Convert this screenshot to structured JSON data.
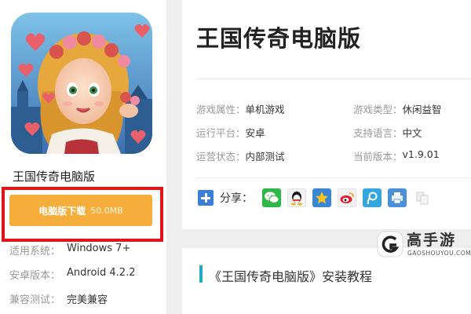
{
  "app": {
    "name": "王国传奇电脑版",
    "title": "王国传奇电脑版"
  },
  "download": {
    "label": "电脑版下载",
    "size": "50.0MB"
  },
  "meta": [
    {
      "key": "适用系统：",
      "value": "Windows 7+"
    },
    {
      "key": "安卓版本：",
      "value": "Android 4.2.2"
    },
    {
      "key": "兼容测试：",
      "value": "完美兼容"
    }
  ],
  "attributes": [
    {
      "key": "游戏属性：",
      "value": "单机游戏"
    },
    {
      "key": "游戏类型：",
      "value": "休闲益智"
    },
    {
      "key": "运行平台：",
      "value": "安卓"
    },
    {
      "key": "支持语言：",
      "value": "中文"
    },
    {
      "key": "运营状态：",
      "value": "内部测试"
    },
    {
      "key": "当前版本：",
      "value": "v1.9.01"
    }
  ],
  "share": {
    "label": "分享：",
    "icons": [
      "wechat-icon",
      "qq-icon",
      "qzone-icon",
      "weibo-icon",
      "tencent-weibo-icon",
      "print-icon",
      "copy-icon"
    ]
  },
  "tutorial": {
    "title": "《王国传奇电脑版》安装教程"
  },
  "watermark": {
    "brand": "高手游",
    "domain": "GAOSHOUYOU.COM"
  },
  "colors": {
    "download_button": "#f5ad3c",
    "highlight_border": "#e2141a",
    "accent_bar": "#1faac7",
    "share_plus": "#3a7fd5"
  }
}
